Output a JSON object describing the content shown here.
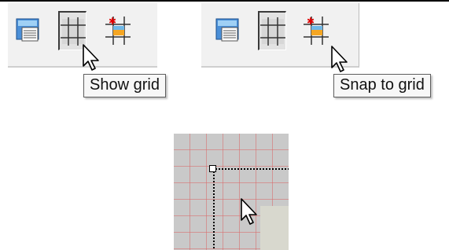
{
  "tooltips": {
    "show_grid": "Show grid",
    "snap_to_grid": "Snap to grid"
  },
  "icons": {
    "dialog_properties": "dialog-properties-icon",
    "show_grid": "grid-icon",
    "snap_to_grid": "snap-to-grid-icon",
    "cursor": "arrow-cursor-icon"
  },
  "colors": {
    "toolbar_bg": "#f1f1f1",
    "grid_line": "#d96868",
    "canvas_bg": "#c9c9c9",
    "tooltip_bg": "#f7f7f7"
  }
}
